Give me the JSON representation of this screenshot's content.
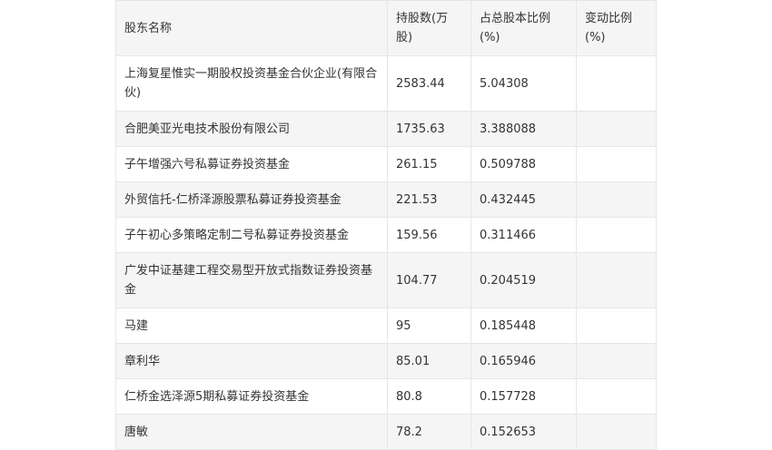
{
  "table": {
    "headers": [
      "股东名称",
      "持股数(万股)",
      "占总股本比例(%)",
      "变动比例(%)"
    ],
    "rows": [
      {
        "name": "上海复星惟实一期股权投资基金合伙企业(有限合伙)",
        "shares": "2583.44",
        "ratio": "5.04308",
        "change": ""
      },
      {
        "name": "合肥美亚光电技术股份有限公司",
        "shares": "1735.63",
        "ratio": "3.388088",
        "change": ""
      },
      {
        "name": "子午增强六号私募证券投资基金",
        "shares": "261.15",
        "ratio": "0.509788",
        "change": ""
      },
      {
        "name": "外贸信托-仁桥泽源股票私募证券投资基金",
        "shares": "221.53",
        "ratio": "0.432445",
        "change": ""
      },
      {
        "name": "子午初心多策略定制二号私募证券投资基金",
        "shares": "159.56",
        "ratio": "0.311466",
        "change": ""
      },
      {
        "name": "广发中证基建工程交易型开放式指数证券投资基金",
        "shares": "104.77",
        "ratio": "0.204519",
        "change": ""
      },
      {
        "name": "马建",
        "shares": "95",
        "ratio": "0.185448",
        "change": ""
      },
      {
        "name": "章利华",
        "shares": "85.01",
        "ratio": "0.165946",
        "change": ""
      },
      {
        "name": "仁桥金选泽源5期私募证券投资基金",
        "shares": "80.8",
        "ratio": "0.157728",
        "change": ""
      },
      {
        "name": "唐敏",
        "shares": "78.2",
        "ratio": "0.152653",
        "change": ""
      }
    ]
  }
}
